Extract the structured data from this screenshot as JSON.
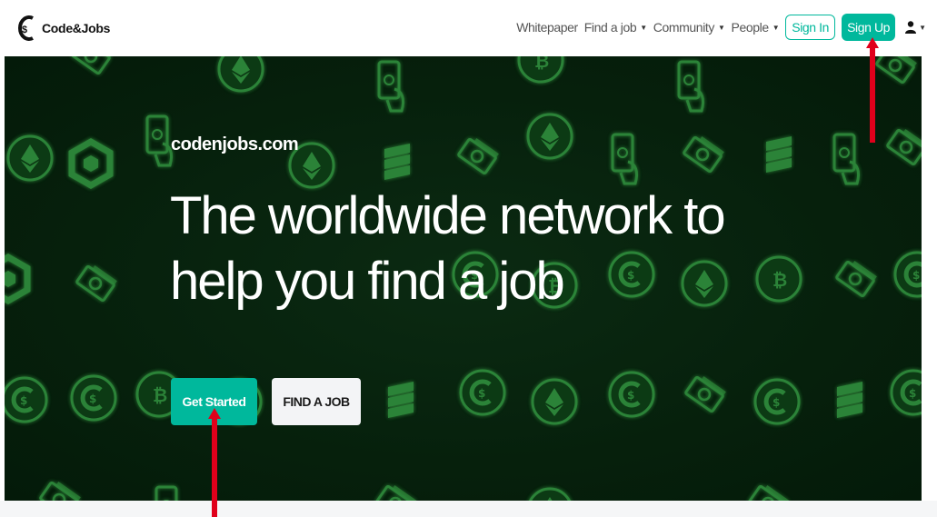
{
  "brand": {
    "name": "Code&Jobs",
    "logo_icon": "c-dollar-logo"
  },
  "nav": {
    "items": [
      {
        "label": "Whitepaper",
        "dropdown": false
      },
      {
        "label": "Find a job",
        "dropdown": true
      },
      {
        "label": "Community",
        "dropdown": true
      },
      {
        "label": "People",
        "dropdown": true
      }
    ],
    "sign_in": "Sign In",
    "sign_up": "Sign Up",
    "user_icon": "user-icon"
  },
  "hero": {
    "domain": "codenjobs.com",
    "title": "The worldwide network to help you find a job",
    "primary_button": "Get Started",
    "secondary_button": "FIND A JOB"
  },
  "colors": {
    "accent": "#00b89c",
    "hero_bg": "#06200c",
    "pattern": "#1f6a2a",
    "arrow": "#e0001b"
  }
}
